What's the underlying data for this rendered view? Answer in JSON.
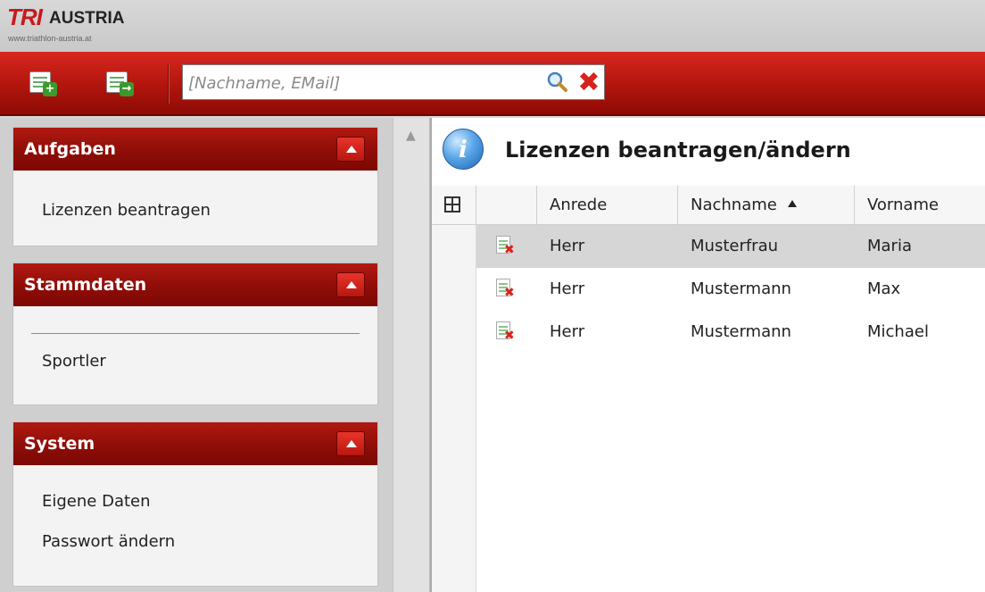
{
  "header": {
    "logo_tri": "TRI",
    "logo_austria": "AUSTRIA",
    "logo_url": "www.triathlon-austria.at"
  },
  "toolbar": {
    "buttons": [
      {
        "name": "add-license-button",
        "icon": "document-add-icon"
      },
      {
        "name": "export-button",
        "icon": "document-arrow-icon"
      }
    ],
    "search": {
      "placeholder": "[Nachname, EMail]",
      "value": ""
    },
    "search_icon": "magnifier-icon",
    "clear_icon": "red-x-icon"
  },
  "sidebar": {
    "panels": [
      {
        "title": "Aufgaben",
        "items": [
          "Lizenzen beantragen"
        ]
      },
      {
        "title": "Stammdaten",
        "items": [
          "Sportler"
        ]
      },
      {
        "title": "System",
        "items": [
          "Eigene Daten",
          "Passwort ändern"
        ]
      }
    ]
  },
  "main": {
    "title": "Lizenzen beantragen/ändern",
    "columns": [
      "Anrede",
      "Nachname",
      "Vorname"
    ],
    "sort_column": "Nachname",
    "sort_direction": "ascending",
    "rows": [
      {
        "anrede": "Herr",
        "nachname": "Musterfrau",
        "vorname": "Maria",
        "selected": true
      },
      {
        "anrede": "Herr",
        "nachname": "Mustermann",
        "vorname": "Max",
        "selected": false
      },
      {
        "anrede": "Herr",
        "nachname": "Mustermann",
        "vorname": "Michael",
        "selected": false
      }
    ]
  },
  "colors": {
    "brand_red": "#b81810",
    "panel_red": "#8f0d08",
    "selected_row": "#d6d6d6"
  }
}
